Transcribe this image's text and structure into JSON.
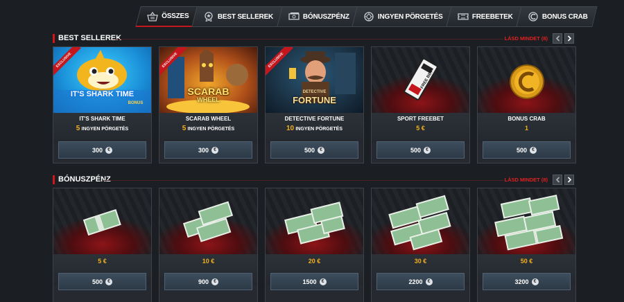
{
  "tabs": [
    {
      "label": "ÖSSZES",
      "icon": "basket-icon",
      "active": true
    },
    {
      "label": "BEST SELLEREK",
      "icon": "medal-icon",
      "active": false
    },
    {
      "label": "BÓNUSZPÉNZ",
      "icon": "cash-icon",
      "active": false
    },
    {
      "label": "INGYEN PÖRGETÉS",
      "icon": "spin-icon",
      "active": false
    },
    {
      "label": "FREEBETEK",
      "icon": "ticket-icon",
      "active": false
    },
    {
      "label": "BONUS CRAB",
      "icon": "crab-coin-icon",
      "active": false
    }
  ],
  "best_sellers": {
    "title": "BEST SELLEREK",
    "see_all": "LÁSD MINDET (8)",
    "cards": [
      {
        "name": "IT'S SHARK TIME",
        "spins_num": "5",
        "spins_label": "INGYEN PÖRGETÉS",
        "price": "300",
        "badge": "EXCLUSIVE",
        "art_title": "IT'S SHARK TIME",
        "art_sub": "BONUS"
      },
      {
        "name": "SCARAB WHEEL",
        "spins_num": "5",
        "spins_label": "INGYEN PÖRGETÉS",
        "price": "300",
        "badge": "EXCLUSIVE",
        "art_title": "SCARAB",
        "art_sub": "WHEEL"
      },
      {
        "name": "DETECTIVE FORTUNE",
        "spins_num": "10",
        "spins_label": "INGYEN PÖRGETÉS",
        "price": "500",
        "badge": "EXCLUSIVE",
        "art_title": "DETECTIVE",
        "art_sub": "FORTUNE"
      },
      {
        "name": "SPORT FREEBET",
        "amount": "5 €",
        "price": "500",
        "art_ticket": "FREE BET"
      },
      {
        "name": "BONUS CRAB",
        "amount": "1",
        "price": "500"
      }
    ]
  },
  "bonus_money": {
    "title": "BÓNUSZPÉNZ",
    "see_all": "LÁSD MINDET (8)",
    "cards": [
      {
        "amount": "5 €",
        "price": "500"
      },
      {
        "amount": "10 €",
        "price": "900"
      },
      {
        "amount": "20 €",
        "price": "1500"
      },
      {
        "amount": "30 €",
        "price": "2200"
      },
      {
        "amount": "50 €",
        "price": "3200"
      }
    ]
  },
  "coin_symbol": "€",
  "colors": {
    "accent": "#d2161c",
    "gold": "#f3b11c",
    "background": "#1b1e23"
  }
}
